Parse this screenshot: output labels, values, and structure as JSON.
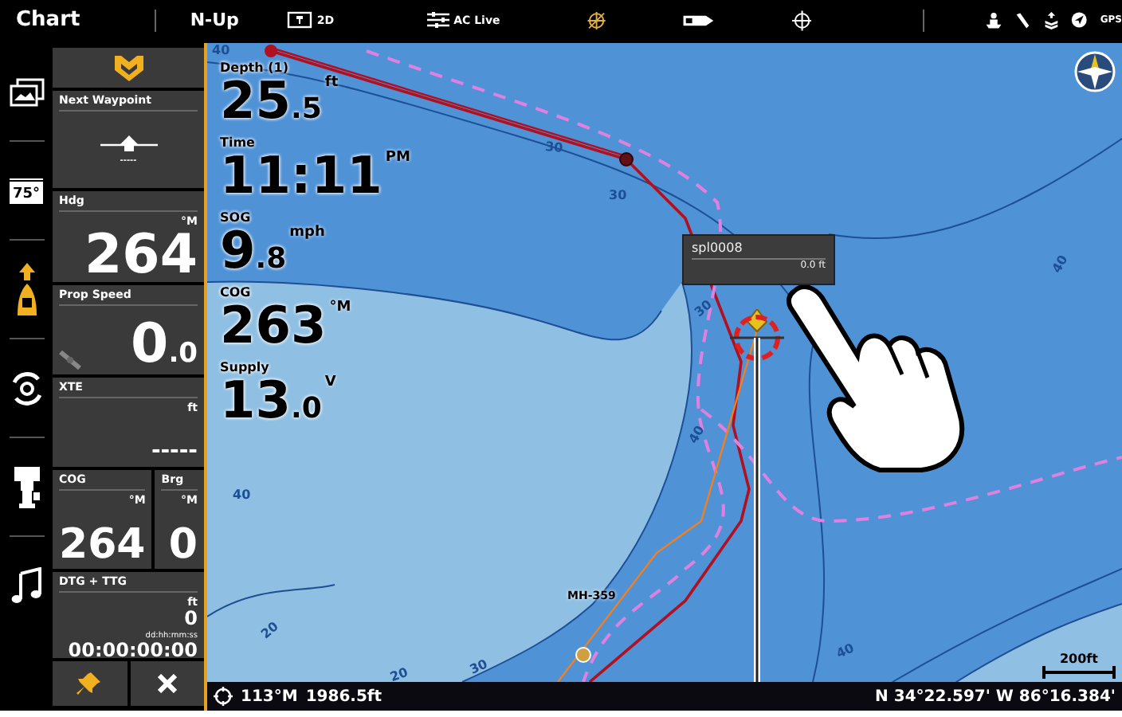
{
  "top_bar": {
    "title": "Chart",
    "orientation": "N-Up",
    "view_mode": "2D",
    "sonar_label": "AC Live",
    "gps_label": "GPS"
  },
  "sidebar": {
    "items": [
      {
        "kind": "layers"
      },
      {
        "kind": "temperature",
        "label": "75°"
      },
      {
        "kind": "boat"
      },
      {
        "kind": "swirl"
      },
      {
        "kind": "motor"
      },
      {
        "kind": "music"
      }
    ]
  },
  "data_panel": {
    "next_waypoint": {
      "label": "Next Waypoint",
      "value": "-----"
    },
    "hdg": {
      "label": "Hdg",
      "unit": "°M",
      "value": "264"
    },
    "prop_speed": {
      "label": "Prop Speed",
      "value": "0.0"
    },
    "xte": {
      "label": "XTE",
      "unit": "ft",
      "value": "-----"
    },
    "cog": {
      "label": "COG",
      "unit": "°M",
      "value": "264"
    },
    "brg": {
      "label": "Brg",
      "unit": "°M",
      "value": "0"
    },
    "dtg_ttg": {
      "label": "DTG + TTG",
      "unit": "ft",
      "distance": "0",
      "time_unit": "dd:hh:mm:ss",
      "time": "00:00:00:00"
    }
  },
  "map": {
    "readings": [
      {
        "label": "Depth (1)",
        "value": "25.5",
        "unit": "ft"
      },
      {
        "label": "Time",
        "value": "11:11",
        "unit": "PM"
      },
      {
        "label": "SOG",
        "value": "9.8",
        "unit": "mph"
      },
      {
        "label": "COG",
        "value": "263",
        "unit": "°M"
      },
      {
        "label": "Supply",
        "value": "13.0",
        "unit": "V"
      }
    ],
    "contour_labels": [
      "40",
      "30",
      "30",
      "30",
      "40",
      "40",
      "40",
      "20",
      "20",
      "30",
      "40"
    ],
    "waypoint_label": "MH-359",
    "tooltip": {
      "name": "spl0008",
      "depth": "0.0 ft"
    },
    "scale": "200ft"
  },
  "status_bar": {
    "heading": "113°M",
    "distance": "1986.5ft",
    "coordinates": "N 34°22.597' W 86°16.384'"
  }
}
